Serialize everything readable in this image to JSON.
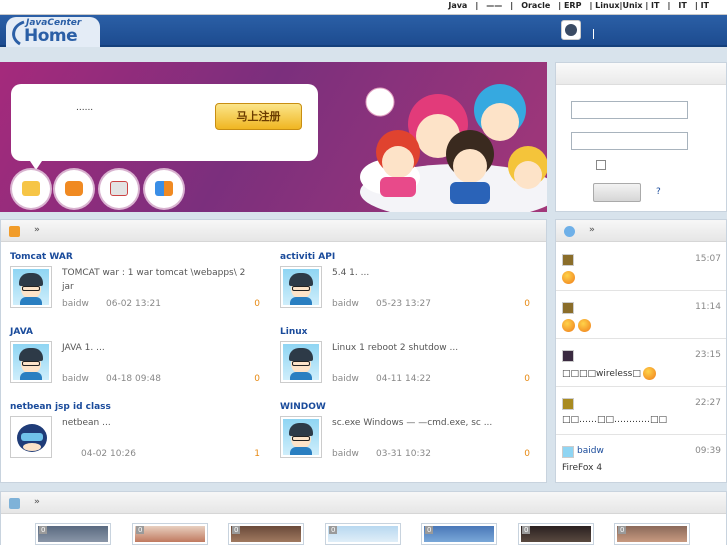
{
  "topbar": {
    "links": [
      "Java",
      "|",
      "——",
      "|",
      "Oracle",
      "| ERP",
      "| Linux|Unix | IT",
      "|",
      "IT",
      "| IT"
    ]
  },
  "header": {
    "logo_line1": "JavaCenter",
    "logo_line2": "Home",
    "separator": "|"
  },
  "banner": {
    "slogan": "......",
    "register_label": "马上注册"
  },
  "login": {
    "forgot_label": "?"
  },
  "articles_section": {
    "arrow": "»",
    "items": [
      {
        "title": "Tomcat   WAR",
        "summary": "TOMCAT  war : 1  war    tomcat \\webapps\\   2    jar",
        "author": "baidw",
        "date": "06-02 13:21",
        "count": "0",
        "avatar": "glasses"
      },
      {
        "title": "activiti API",
        "summary": "5.4         1.                     ...",
        "author": "baidw",
        "date": "05-23 13:27",
        "count": "0",
        "avatar": "glasses"
      },
      {
        "title": "JAVA",
        "summary": "JAVA     1.                              ...",
        "author": "baidw",
        "date": "04-18 09:48",
        "count": "0",
        "avatar": "glasses"
      },
      {
        "title": "Linux",
        "summary": "Linux          1 reboot 2 shutdow ...",
        "author": "baidw",
        "date": "04-11 14:22",
        "count": "0",
        "avatar": "glasses"
      },
      {
        "title": "netbean  jsp    id class",
        "summary": "netbean                                   ...",
        "author": "",
        "date": "04-02 10:26",
        "count": "1",
        "avatar": "mask"
      },
      {
        "title": "WINDOW",
        "summary": "sc.exe    Windows     — —cmd.exe,    sc ...",
        "author": "baidw",
        "date": "03-31 10:32",
        "count": "0",
        "avatar": "glasses"
      }
    ]
  },
  "feed_section": {
    "arrow": "»",
    "items": [
      {
        "name": "",
        "time": "15:07",
        "text": "",
        "emoji_count": 1
      },
      {
        "name": "",
        "time": "11:14",
        "text": "",
        "emoji_count": 2
      },
      {
        "name": "",
        "time": "23:15",
        "text": "□□□□wireless□",
        "emoji_count": 1
      },
      {
        "name": "",
        "time": "22:27",
        "text": "□□……□□…………□□",
        "emoji_count": 0
      },
      {
        "name": "baidw",
        "time": "09:39",
        "text": "FireFox 4",
        "emoji_count": 0
      }
    ]
  },
  "gallery_section": {
    "arrow": "»",
    "badges": [
      "0",
      "0",
      "0",
      "0",
      "0",
      "0",
      "0"
    ]
  },
  "colors": {
    "header_blue": "#2b5fa6",
    "banner_purple": "#a52a7c",
    "link_blue": "#1a4b9b",
    "count_orange": "#e78a14",
    "button_gold": "#f0b622"
  }
}
